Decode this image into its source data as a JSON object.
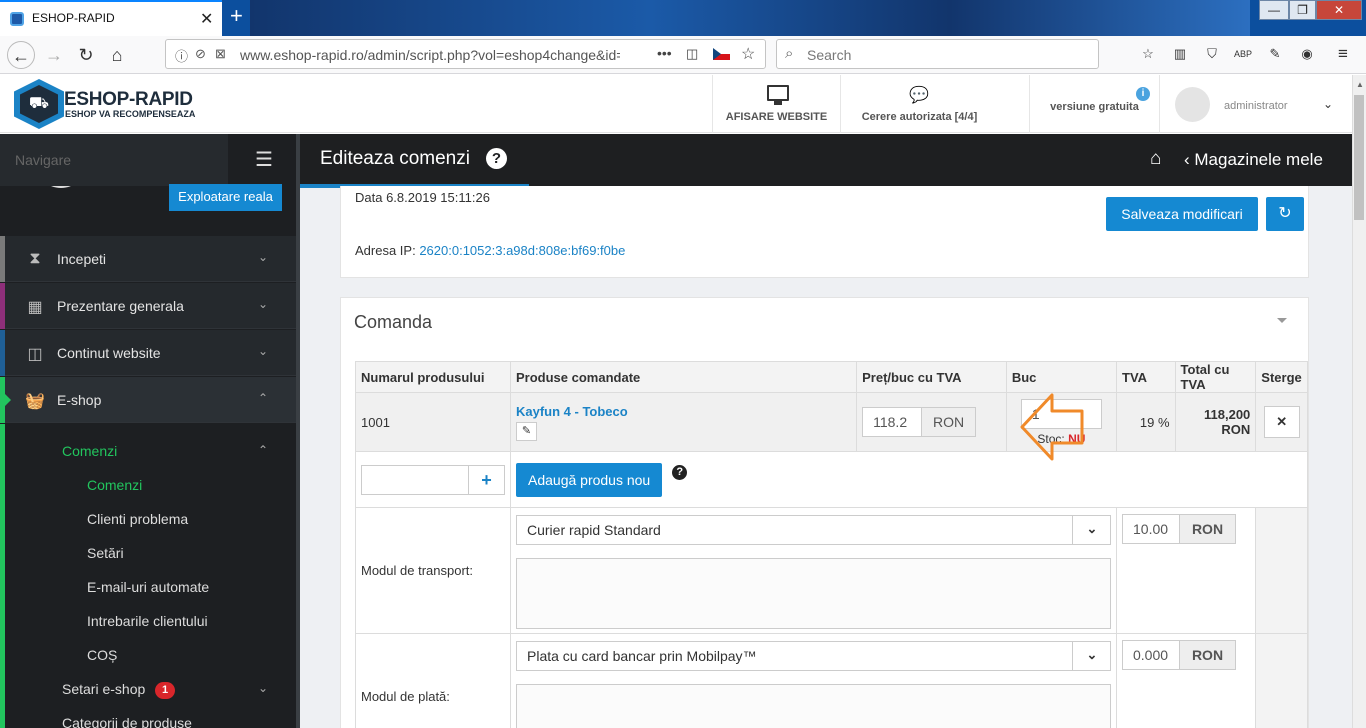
{
  "browser": {
    "tab_title": "ESHOP-RAPID",
    "tab_close": "✕",
    "new_tab": "+",
    "url": "www.eshop-rapid.ro/admin/script.php?vol=eshop4change&id=",
    "search_placeholder": "Search",
    "win_buttons": [
      "—",
      "❐",
      "✕"
    ]
  },
  "header": {
    "logo_title": "ESHOP-RAPID",
    "logo_subtitle": "ESHOP VA RECOMPENSEAZA",
    "afisare_website": "AFISARE WEBSITE",
    "cereri": "Cerere autorizata [4/4]",
    "versiune": "versiune gratuita",
    "user": "administrator"
  },
  "sidebar": {
    "nav_label": "Navigare",
    "explore_button": "Exploatare reala",
    "items": [
      {
        "label": "Incepeti",
        "color": "#7a7a7a",
        "icon": "hourglass-icon"
      },
      {
        "label": "Prezentare generala",
        "color": "#8e2f7a",
        "icon": "grid-icon"
      },
      {
        "label": "Continut website",
        "color": "#1f5f96",
        "icon": "columns-icon"
      },
      {
        "label": "E-shop",
        "color": "#22c55e",
        "icon": "basket-icon"
      }
    ],
    "comenzi_label": "Comenzi",
    "subitems": [
      "Comenzi",
      "Clienti problema",
      "Setări",
      "E-mail-uri automate",
      "Intrebarile clientului",
      "COȘ"
    ],
    "setari_eshop": "Setari e-shop",
    "setari_badge": "1",
    "categorii": "Categorii de produse"
  },
  "main": {
    "title": "Editeaza comenzi",
    "crumb": "Magazinele mele",
    "date_text": "Data 6.8.2019 15:11:26",
    "save_button": "Salveaza modificari",
    "ip_label": "Adresa IP:",
    "ip_value": "2620:0:1052:3:a98d:808e:bf69:f0be",
    "section_title": "Comanda",
    "table": {
      "headers": [
        "Numarul produsului",
        "Produse comandate",
        "Preț/buc cu TVA",
        "Buc",
        "TVA",
        "Total cu TVA",
        "Sterge"
      ],
      "row": {
        "number": "1001",
        "product": "Kayfun 4 - Tobeco",
        "price": "118.2",
        "currency": "RON",
        "qty": "1",
        "stock_label": "Stoc:",
        "stock_value": "NU",
        "tva": "19 %",
        "total": "118,200 RON",
        "delete": "✕"
      }
    },
    "add_product_button": "Adaugă produs nou",
    "transport_label": "Modul de transport:",
    "transport_value": "Curier rapid Standard",
    "transport_price": "10.00",
    "payment_label": "Modul de plată:",
    "payment_value": "Plata cu card bancar prin Mobilpay™",
    "payment_price": "0.000",
    "currency": "RON"
  }
}
